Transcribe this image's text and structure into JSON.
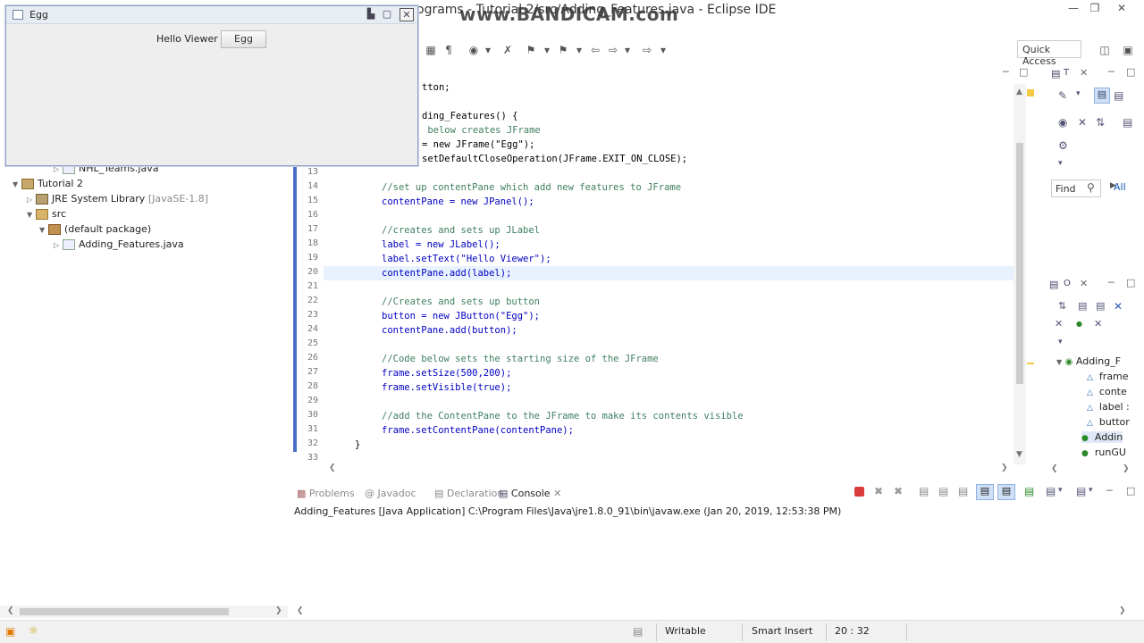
{
  "window": {
    "title_partial": "ograms - Tutorial 2/src/Adding_Features.java - Eclipse IDE",
    "watermark": "www.BANDICAM.com"
  },
  "toolbar": {
    "quick_access": "Quick Access"
  },
  "egg_window": {
    "title": "Egg",
    "label": "Hello Viewer",
    "button": "Egg"
  },
  "package_explorer": {
    "items": [
      {
        "label": "NHL_Teams.java",
        "extra": ""
      },
      {
        "label": "Tutorial 2",
        "extra": ""
      },
      {
        "label": "JRE System Library",
        "extra": "[JavaSE-1.8]"
      },
      {
        "label": "src",
        "extra": ""
      },
      {
        "label": "(default package)",
        "extra": ""
      },
      {
        "label": "Adding_Features.java",
        "extra": ""
      }
    ]
  },
  "editor": {
    "lines": [
      {
        "num": "",
        "text": "tton;"
      },
      {
        "num": "",
        "text": ""
      },
      {
        "num": "",
        "text": "ding_Features() {"
      },
      {
        "num": "",
        "text": " below creates JFrame"
      },
      {
        "num": "",
        "text": "= new JFrame(\"Egg\");"
      },
      {
        "num": "13",
        "text": "setDefaultCloseOperation(JFrame.EXIT_ON_CLOSE);"
      },
      {
        "num": "14",
        "text": "//set up contentPane which add new features to JFrame"
      },
      {
        "num": "15",
        "text": "contentPane = new JPanel();"
      },
      {
        "num": "16",
        "text": ""
      },
      {
        "num": "17",
        "text": "//creates and sets up JLabel"
      },
      {
        "num": "18",
        "text": "label = new JLabel();"
      },
      {
        "num": "19",
        "text": "label.setText(\"Hello Viewer\");"
      },
      {
        "num": "20",
        "text": "contentPane.add(label);"
      },
      {
        "num": "21",
        "text": ""
      },
      {
        "num": "22",
        "text": "//Creates and sets up button"
      },
      {
        "num": "23",
        "text": "button = new JButton(\"Egg\");"
      },
      {
        "num": "24",
        "text": "contentPane.add(button);"
      },
      {
        "num": "25",
        "text": ""
      },
      {
        "num": "26",
        "text": "//Code below sets the starting size of the JFrame"
      },
      {
        "num": "27",
        "text": "frame.setSize(500,200);"
      },
      {
        "num": "28",
        "text": "frame.setVisible(true);"
      },
      {
        "num": "29",
        "text": ""
      },
      {
        "num": "30",
        "text": "//add the ContentPane to the JFrame to make its contents visible"
      },
      {
        "num": "31",
        "text": "frame.setContentPane(contentPane);"
      },
      {
        "num": "32",
        "text": "}"
      },
      {
        "num": "33",
        "text": ""
      }
    ]
  },
  "console": {
    "tabs": [
      "Problems",
      "Javadoc",
      "Declaration",
      "Console"
    ],
    "output": "Adding_Features [Java Application] C:\\Program Files\\Java\\jre1.8.0_91\\bin\\javaw.exe (Jan 20, 2019, 12:53:38 PM)"
  },
  "right_panel": {
    "find_label": "Find",
    "all_label": "All",
    "outline": [
      "Adding_F",
      "frame",
      "conte",
      "label :",
      "buttor",
      "Addin",
      "runGU"
    ]
  },
  "statusbar": {
    "writable": "Writable",
    "insert_mode": "Smart Insert",
    "position": "20 : 32"
  },
  "colors": {
    "keyword": "#7f0055",
    "comment": "#3f7f5f",
    "string": "#2a00ff",
    "field": "#0000c0",
    "accent": "#4a6ec8"
  }
}
